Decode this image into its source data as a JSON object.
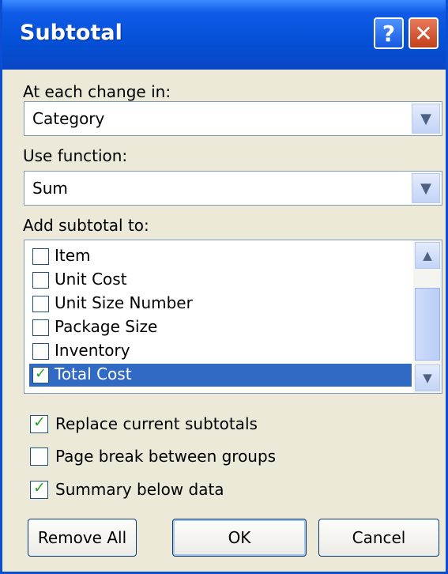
{
  "window": {
    "title": "Subtotal",
    "help_label": "?",
    "close_label": "✕"
  },
  "at_each_change": {
    "label": "At each change in:",
    "value": "Category"
  },
  "use_function": {
    "label": "Use function:",
    "value": "Sum"
  },
  "add_subtotal": {
    "label": "Add subtotal to:",
    "items": [
      {
        "label": "Item",
        "checked": false,
        "selected": false
      },
      {
        "label": "Unit Cost",
        "checked": false,
        "selected": false
      },
      {
        "label": "Unit Size Number",
        "checked": false,
        "selected": false
      },
      {
        "label": "Package Size",
        "checked": false,
        "selected": false
      },
      {
        "label": "Inventory",
        "checked": false,
        "selected": false
      },
      {
        "label": "Total Cost",
        "checked": true,
        "selected": true
      }
    ]
  },
  "options": {
    "replace_current": {
      "label": "Replace current subtotals",
      "checked": true
    },
    "page_break": {
      "label": "Page break between groups",
      "checked": false
    },
    "summary_below": {
      "label": "Summary below data",
      "checked": true
    }
  },
  "buttons": {
    "remove_all": "Remove All",
    "ok": "OK",
    "cancel": "Cancel"
  },
  "icons": {
    "dropdown": "chevron-down-icon",
    "scroll_up": "chevron-up-icon",
    "scroll_down": "chevron-down-icon",
    "check": "checkmark-icon"
  },
  "colors": {
    "titlebar": "#0450d6",
    "selection": "#316ac5",
    "dialog_bg": "#ece9d8",
    "check": "#21a121"
  }
}
